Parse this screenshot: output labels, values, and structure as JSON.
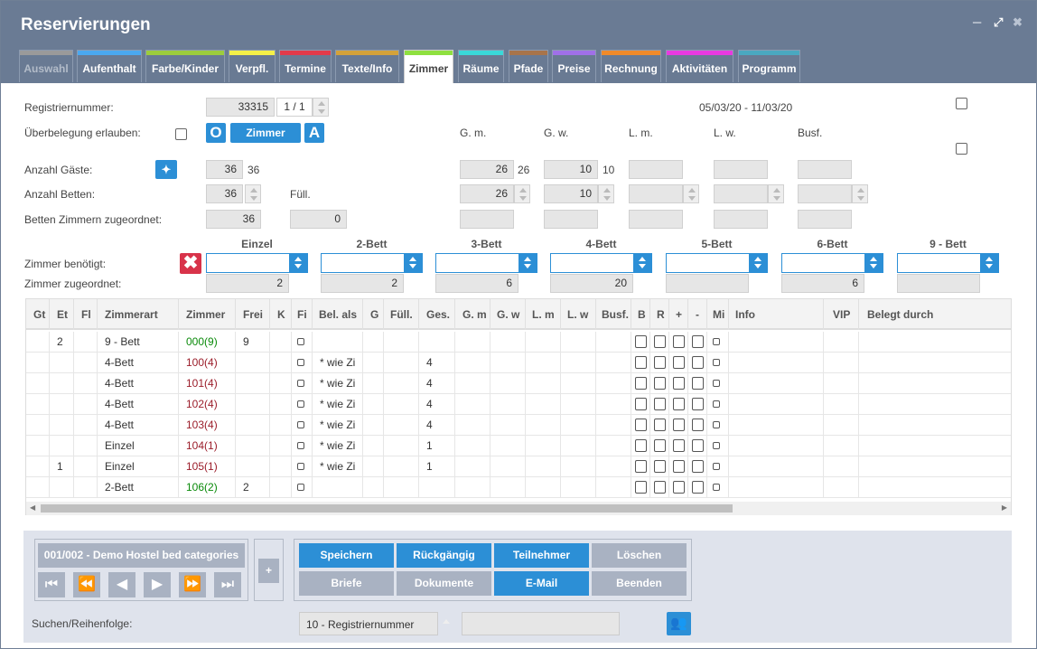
{
  "window": {
    "title": "Reservierungen"
  },
  "tabs": [
    {
      "label": "Auswahl",
      "color": "#9a9a9a"
    },
    {
      "label": "Aufenthalt",
      "color": "#4aa8f0"
    },
    {
      "label": "Farbe/Kinder",
      "color": "#9ccc3c"
    },
    {
      "label": "Verpfl.",
      "color": "#f4f048"
    },
    {
      "label": "Termine",
      "color": "#e23a4a"
    },
    {
      "label": "Texte/Info",
      "color": "#d4a23a"
    },
    {
      "label": "Zimmer",
      "color": "#8fe040"
    },
    {
      "label": "Räume",
      "color": "#3ad8d8"
    },
    {
      "label": "Pfade",
      "color": "#a8744a"
    },
    {
      "label": "Preise",
      "color": "#a070e8"
    },
    {
      "label": "Rechnung",
      "color": "#f08a2a"
    },
    {
      "label": "Aktivitäten",
      "color": "#e83ae0"
    },
    {
      "label": "Programm",
      "color": "#4aa8c0"
    }
  ],
  "form": {
    "reg_label": "Registriernummer:",
    "reg_value": "33315",
    "reg_counter": "1 / 1",
    "date_range": "05/03/20  - 11/03/20",
    "overbooking_label": "Überbelegung erlauben:",
    "btn_o": "O",
    "btn_zimmer": "Zimmer",
    "btn_a": "A",
    "col_gm": "G. m.",
    "col_gw": "G. w.",
    "col_lm": "L. m.",
    "col_lw": "L. w.",
    "col_busf": "Busf.",
    "guests_label": "Anzahl Gäste:",
    "guests_value": "36",
    "guests_value2": "36",
    "gm_guests": "26",
    "gm_guests2": "26",
    "gw_guests": "10",
    "gw_guests2": "10",
    "beds_label": "Anzahl Betten:",
    "beds_value": "36",
    "fill_label": "Füll.",
    "gm_beds": "26",
    "gw_beds": "10",
    "assigned_label": "Betten Zimmern zugeordnet:",
    "assigned_value": "36",
    "fill_value": "0"
  },
  "roomtypes": {
    "headers": [
      "Einzel",
      "2-Bett",
      "3-Bett",
      "4-Bett",
      "5-Bett",
      "6-Bett",
      "9 - Bett"
    ],
    "needed_label": "Zimmer benötigt:",
    "assigned_label": "Zimmer zugeordnet:",
    "assigned_values": [
      "2",
      "2",
      "6",
      "20",
      "",
      "6",
      ""
    ]
  },
  "grid": {
    "columns": [
      "Gt",
      "Et",
      "Fl",
      "Zimmerart",
      "Zimmer",
      "Frei",
      "K",
      "Fi",
      "Bel. als",
      "G",
      "Füll.",
      "Ges.",
      "G. m",
      "G. w",
      "L. m",
      "L. w",
      "Busf.",
      "B",
      "R",
      "+",
      "-",
      "Mi",
      "Info",
      "VIP",
      "Belegt durch"
    ],
    "rows": [
      {
        "et": "2",
        "art": "9 - Bett",
        "zimmer": "000(9)",
        "frei": "9",
        "bel": "",
        "ges": "",
        "status": "green"
      },
      {
        "et": "",
        "art": "4-Bett",
        "zimmer": "100(4)",
        "frei": "",
        "bel": "* wie Zi",
        "ges": "4",
        "status": "red"
      },
      {
        "et": "",
        "art": "4-Bett",
        "zimmer": "101(4)",
        "frei": "",
        "bel": "* wie Zi",
        "ges": "4",
        "status": "red"
      },
      {
        "et": "",
        "art": "4-Bett",
        "zimmer": "102(4)",
        "frei": "",
        "bel": "* wie Zi",
        "ges": "4",
        "status": "red"
      },
      {
        "et": "",
        "art": "4-Bett",
        "zimmer": "103(4)",
        "frei": "",
        "bel": "* wie Zi",
        "ges": "4",
        "status": "red"
      },
      {
        "et": "",
        "art": "Einzel",
        "zimmer": "104(1)",
        "frei": "",
        "bel": "* wie Zi",
        "ges": "1",
        "status": "red"
      },
      {
        "et": "1",
        "art": "Einzel",
        "zimmer": "105(1)",
        "frei": "",
        "bel": "* wie Zi",
        "ges": "1",
        "status": "red"
      },
      {
        "et": "",
        "art": "2-Bett",
        "zimmer": "106(2)",
        "frei": "2",
        "bel": "",
        "ges": "",
        "status": "green"
      }
    ]
  },
  "footer": {
    "record": "001/002 - Demo Hostel bed categories",
    "plus": "+",
    "save": "Speichern",
    "undo": "Rückgängig",
    "participants": "Teilnehmer",
    "delete": "Löschen",
    "letters": "Briefe",
    "documents": "Dokumente",
    "email": "E-Mail",
    "close": "Beenden",
    "search_label": "Suchen/Reihenfolge:",
    "search_value": "10 - Registriernummer",
    "search_input": ""
  }
}
